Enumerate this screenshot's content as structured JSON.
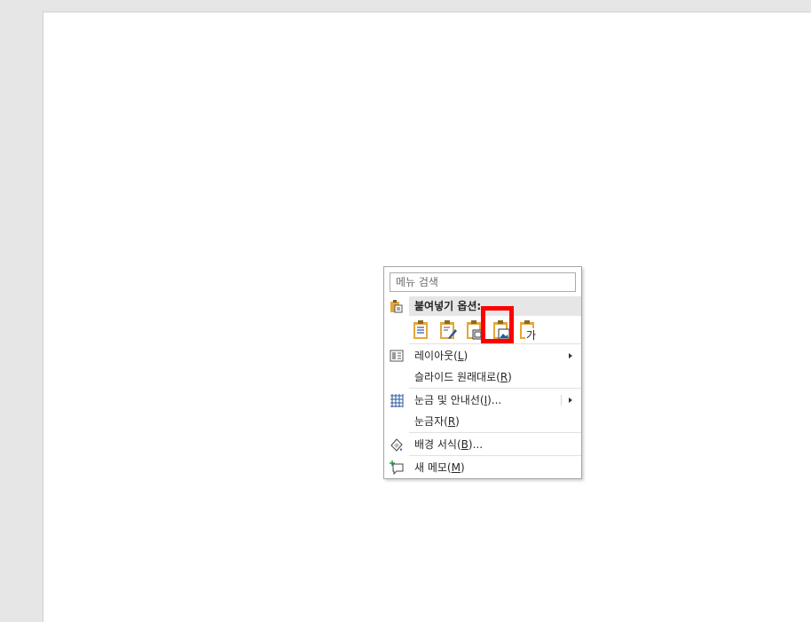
{
  "menu": {
    "search_placeholder": "메뉴 검색",
    "paste_header": "붙여넣기 옵션:",
    "paste_option_text_glyph": "가",
    "items": [
      {
        "label": "레이아웃(",
        "key": "L",
        "suffix": ")",
        "icon": "layout-icon",
        "submenu": true
      },
      {
        "label": "슬라이드 원래대로(",
        "key": "R",
        "suffix": ")",
        "icon": "",
        "submenu": false
      },
      {
        "label": "눈금 및 안내선(",
        "key": "I",
        "suffix": ")...",
        "icon": "grid-icon",
        "submenu": true
      },
      {
        "label": "눈금자(",
        "key": "R",
        "suffix": ")",
        "icon": "",
        "submenu": false
      },
      {
        "label": "배경 서식(",
        "key": "B",
        "suffix": ")...",
        "icon": "format-background-icon",
        "submenu": false
      },
      {
        "label": "새 메모(",
        "key": "M",
        "suffix": ")",
        "icon": "new-comment-icon",
        "submenu": false
      }
    ]
  },
  "colors": {
    "highlight": "#ff0000",
    "clipboard": "#e3a73a",
    "accent_blue": "#2b579a"
  }
}
